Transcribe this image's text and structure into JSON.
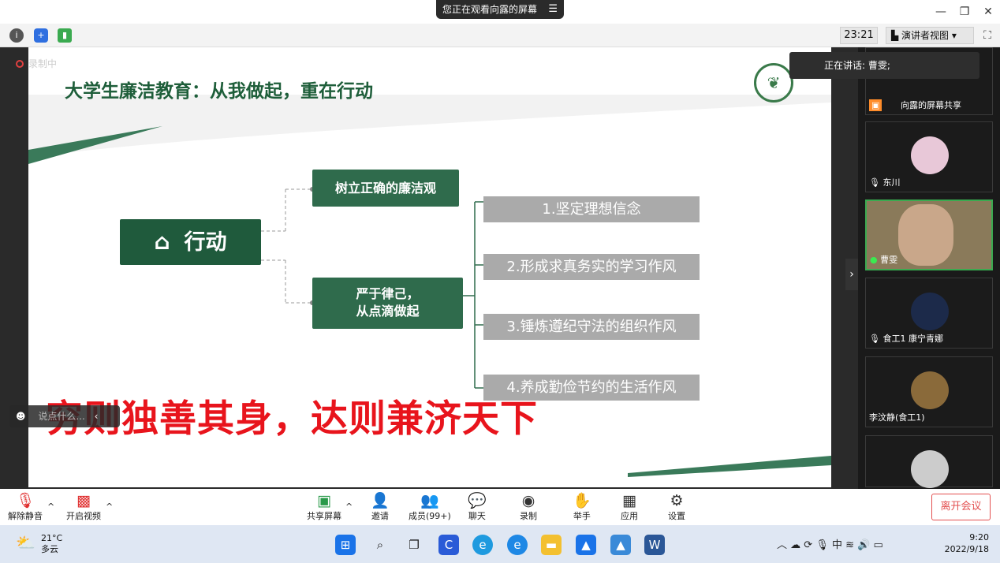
{
  "window": {
    "banner": "您正在观看向露的屏幕",
    "banner_menu": "☰",
    "min": "—",
    "max": "❐",
    "close": "✕"
  },
  "topbar": {
    "timer": "23:21",
    "view_button": "演讲者视图"
  },
  "recording": "录制中",
  "slide": {
    "title": "大学生廉洁教育：从我做起，重在行动",
    "logo_char": "❦",
    "main_node": "行动",
    "node1": "树立正确的廉洁观",
    "node2_line1": "严于律己，",
    "node2_line2": "从点滴做起",
    "items": [
      "1.坚定理想信念",
      "2.形成求真务实的学习作风",
      "3.锤炼遵纪守法的组织作风",
      "4.养成勤俭节约的生活作风"
    ]
  },
  "overlay_text": "穷则独善其身，达则兼济天下",
  "chat_placeholder": "说点什么...",
  "speaking": "正在讲话: 曹雯;",
  "participants": [
    {
      "name": "向露的屏幕共享",
      "color": "#c98a8a"
    },
    {
      "name": "东川",
      "color": "#e8c8d8"
    },
    {
      "name": "曹雯",
      "color": "#c9a78a"
    },
    {
      "name": "食工1  康宁青娜",
      "color": "#1c2a4a"
    },
    {
      "name": "李汶静(食工1)",
      "color": "#8a6a3a"
    },
    {
      "name": "",
      "color": "#cccccc"
    }
  ],
  "bottombar": {
    "unmute": "解除静音",
    "video": "开启视频",
    "share": "共享屏幕",
    "invite": "邀请",
    "members": "成员(99+)",
    "chat": "聊天",
    "record": "录制",
    "raise": "举手",
    "apps": "应用",
    "settings": "设置",
    "leave": "离开会议"
  },
  "taskbar": {
    "temp": "21°C",
    "weather": "多云",
    "ime": "中",
    "time": "9:20",
    "date": "2022/9/18"
  }
}
